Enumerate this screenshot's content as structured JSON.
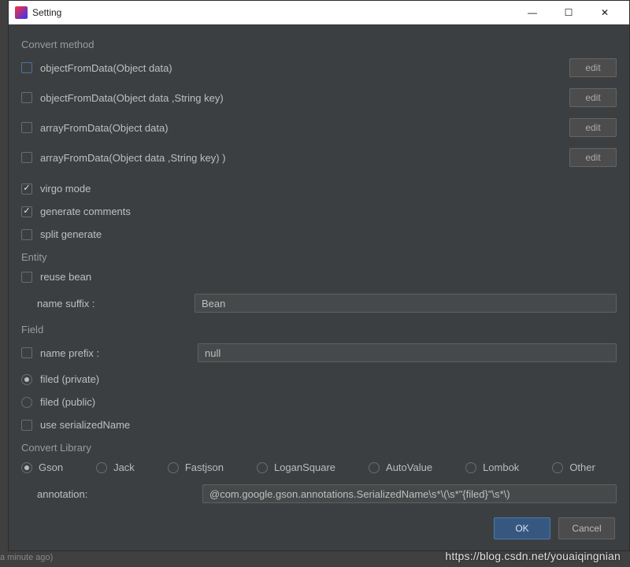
{
  "window": {
    "title": "Setting"
  },
  "convert_method": {
    "section_label": "Convert method",
    "items": [
      {
        "label": "objectFromData(Object data)",
        "edit": "edit"
      },
      {
        "label": "objectFromData(Object data ,String key)",
        "edit": "edit"
      },
      {
        "label": "arrayFromData(Object data)",
        "edit": "edit"
      },
      {
        "label": "arrayFromData(Object data ,String key) )",
        "edit": "edit"
      }
    ]
  },
  "options": {
    "virgo_mode": "virgo mode",
    "generate_comments": "generate comments",
    "split_generate": "split generate"
  },
  "entity": {
    "section_label": "Entity",
    "reuse_bean": "reuse bean",
    "name_suffix_label": "name suffix :",
    "name_suffix_value": "Bean"
  },
  "field": {
    "section_label": "Field",
    "name_prefix_label": "name prefix :",
    "name_prefix_value": "null",
    "private_label": "filed (private)",
    "public_label": "filed (public)",
    "use_serialized": "use serializedName"
  },
  "library": {
    "section_label": "Convert Library",
    "options": [
      "Gson",
      "Jack",
      "Fastjson",
      "LoganSquare",
      "AutoValue",
      "Lombok",
      "Other"
    ],
    "annotation_label": "annotation:",
    "annotation_value": "@com.google.gson.annotations.SerializedName\\s*\\(\\s*\"{filed}\"\\s*\\)"
  },
  "footer": {
    "ok": "OK",
    "cancel": "Cancel"
  },
  "watermark": "https://blog.csdn.net/youaiqingnian",
  "bg_text": "a minute ago)"
}
